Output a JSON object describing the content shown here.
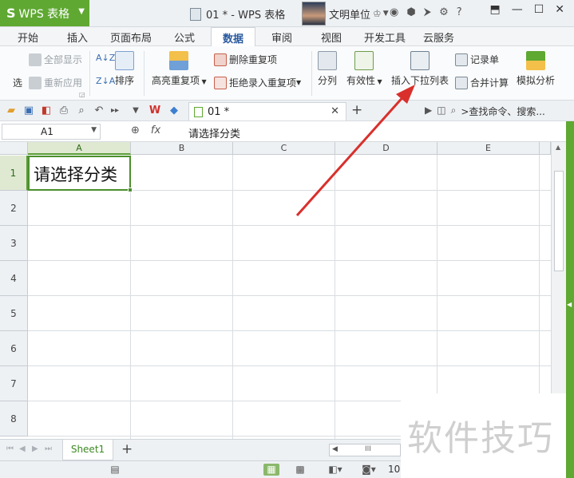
{
  "titlebar": {
    "app_name": "WPS 表格",
    "doc_title": "01 * - WPS 表格",
    "user_name": "文明单位",
    "help": "?"
  },
  "ribbon_tabs": [
    "开始",
    "插入",
    "页面布局",
    "公式",
    "数据",
    "审阅",
    "视图",
    "开发工具",
    "云服务"
  ],
  "active_tab": "数据",
  "ribbon": {
    "filter_partial": "选",
    "show_all": "全部显示",
    "reapply": "重新应用",
    "sort": "排序",
    "highlight_dup": "高亮重复项",
    "remove_dup": "删除重复项",
    "reject_dup": "拒绝录入重复项",
    "split": "分列",
    "validity": "有效性",
    "insert_dropdown": "插入下拉列表",
    "record_form": "记录单",
    "consolidate": "合并计算",
    "simulate": "模拟分析"
  },
  "quickbar": {
    "doc_tab": "01 *",
    "search": ">查找命令、搜索..."
  },
  "formula": {
    "name_box": "A1",
    "fx": "fx",
    "content": "请选择分类"
  },
  "grid": {
    "columns": [
      "A",
      "B",
      "C",
      "D",
      "E"
    ],
    "rows": [
      "1",
      "2",
      "3",
      "4",
      "5",
      "6",
      "7",
      "8"
    ],
    "a1_value": "请选择分类"
  },
  "sheet_tab": "Sheet1",
  "zoom_partial": "10",
  "watermark": "软件技巧",
  "colors": {
    "wps_green": "#5fa832",
    "selected_green": "#4b8f2d",
    "arrow_red": "#d9302c"
  }
}
